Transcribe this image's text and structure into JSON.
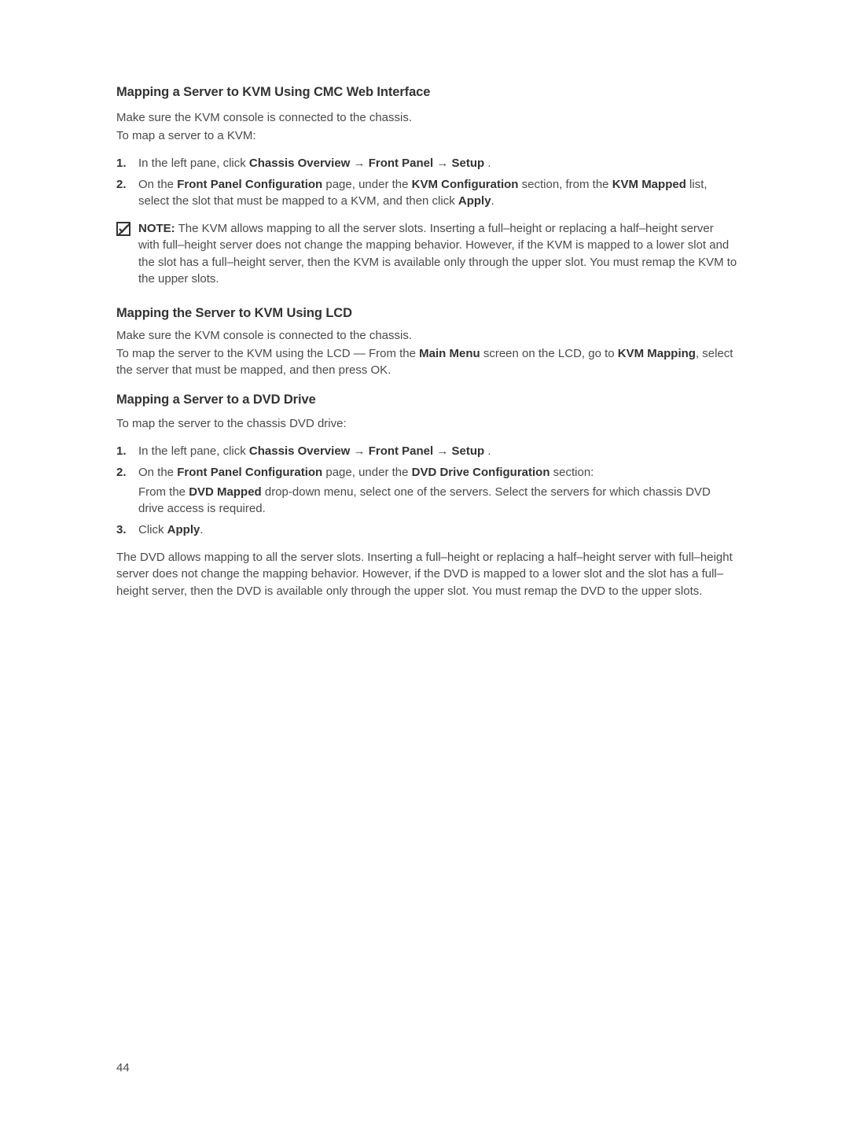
{
  "section1": {
    "heading": "Mapping a Server to KVM Using CMC Web Interface",
    "intro1": "Make sure the KVM console is connected to the chassis.",
    "intro2": "To map a server to a KVM:",
    "list": {
      "n1": "1.",
      "item1_pre": "In the left pane, click ",
      "item1_bold1": "Chassis Overview",
      "item1_arrow1": " → ",
      "item1_bold2": "Front Panel",
      "item1_arrow2": " → ",
      "item1_bold3": "Setup",
      "item1_post": " .",
      "n2": "2.",
      "item2_pre": "On the ",
      "item2_bold1": "Front Panel Configuration",
      "item2_mid1": " page, under the ",
      "item2_bold2": "KVM Configuration",
      "item2_mid2": " section, from the ",
      "item2_bold3": "KVM Mapped",
      "item2_mid3": " list, select the slot that must be mapped to a KVM, and then click ",
      "item2_bold4": "Apply",
      "item2_post": "."
    },
    "note": {
      "label": "NOTE:",
      "text": " The KVM allows mapping to all the server slots. Inserting a full–height or replacing a half–height server with full–height server does not change the mapping behavior. However, if the KVM is mapped to a lower slot and the slot has a full–height server, then the KVM is available only through the upper slot. You must remap the KVM to the upper slots."
    }
  },
  "section2": {
    "heading": "Mapping the Server to KVM Using LCD",
    "intro1": "Make sure the KVM console is connected to the chassis.",
    "intro2_pre": "To map the server to the KVM using the LCD — From the ",
    "intro2_bold1": "Main Menu",
    "intro2_mid": " screen on the LCD, go to ",
    "intro2_bold2": "KVM Mapping",
    "intro2_post": ", select the server that must be mapped, and then press OK."
  },
  "section3": {
    "heading": "Mapping a Server to a DVD Drive",
    "intro": "To map the server to the chassis DVD drive:",
    "list": {
      "n1": "1.",
      "item1_pre": "In the left pane, click ",
      "item1_bold1": "Chassis Overview",
      "item1_arrow1": " → ",
      "item1_bold2": "Front Panel",
      "item1_arrow2": " → ",
      "item1_bold3": "Setup",
      "item1_post": " .",
      "n2": "2.",
      "item2_pre": "On the ",
      "item2_bold1": "Front Panel Configuration",
      "item2_mid1": " page, under the ",
      "item2_bold2": "DVD Drive Configuration",
      "item2_mid2": " section:",
      "item2b_pre": "From the ",
      "item2b_bold": "DVD Mapped",
      "item2b_post": " drop-down menu, select one of the servers. Select the servers for which chassis DVD drive access is required.",
      "n3": "3.",
      "item3_pre": "Click ",
      "item3_bold": "Apply",
      "item3_post": "."
    },
    "closing": "The DVD allows mapping to all the server slots. Inserting a full–height or replacing a half–height server with full–height server does not change the mapping behavior. However, if the DVD is mapped to a lower slot and the slot has a full–height server, then the DVD is available only through the upper slot. You must remap the DVD to the upper slots."
  },
  "pageNumber": "44"
}
